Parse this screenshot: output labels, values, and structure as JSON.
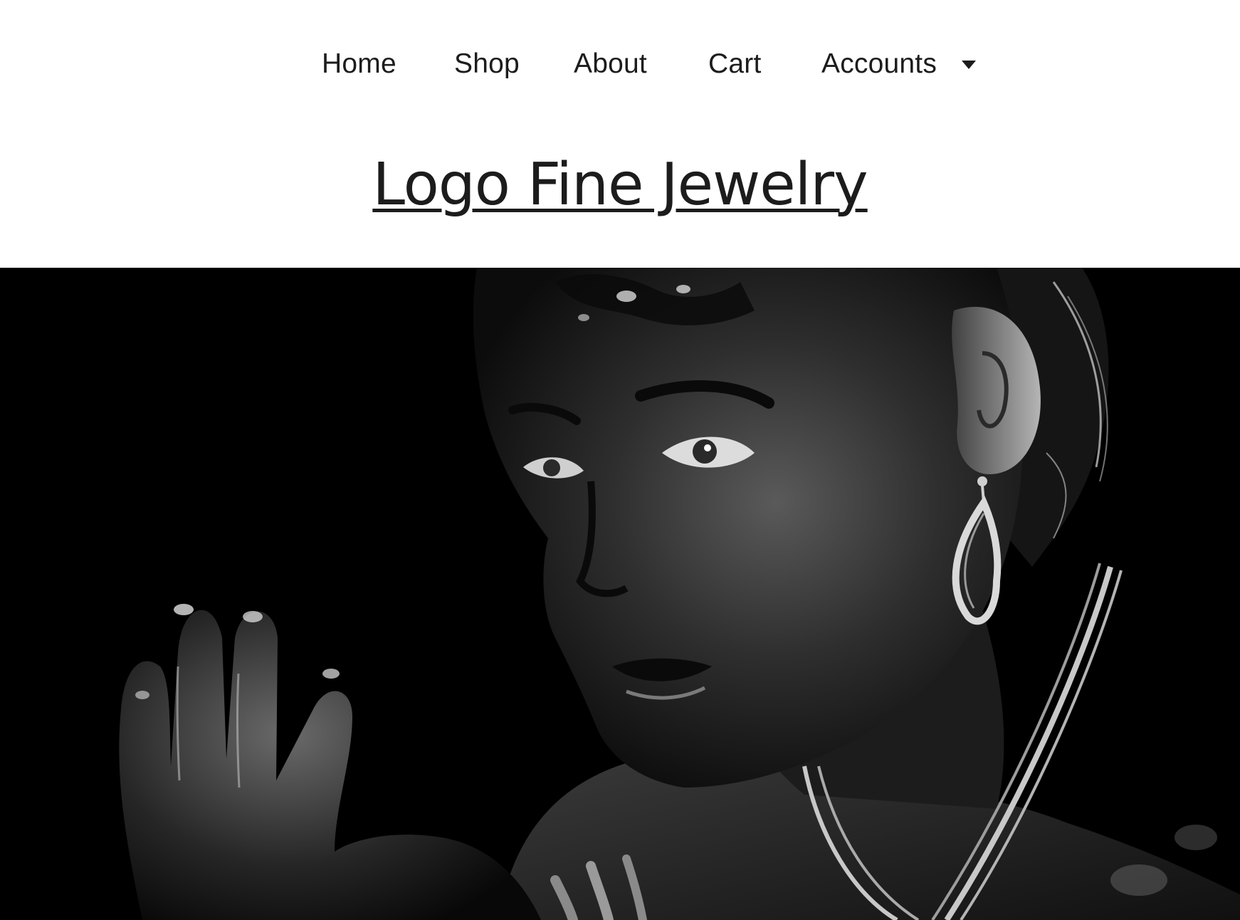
{
  "nav": {
    "items": [
      {
        "label": "Home"
      },
      {
        "label": "Shop"
      },
      {
        "label": "About"
      },
      {
        "label": "Cart"
      },
      {
        "label": "Accounts"
      }
    ],
    "dropdown_icon": "caret-down-icon"
  },
  "logo": {
    "text": "Logo Fine Jewelry"
  },
  "colors": {
    "text": "#1c1c1c",
    "background": "#ffffff",
    "hero_background": "#000000"
  }
}
